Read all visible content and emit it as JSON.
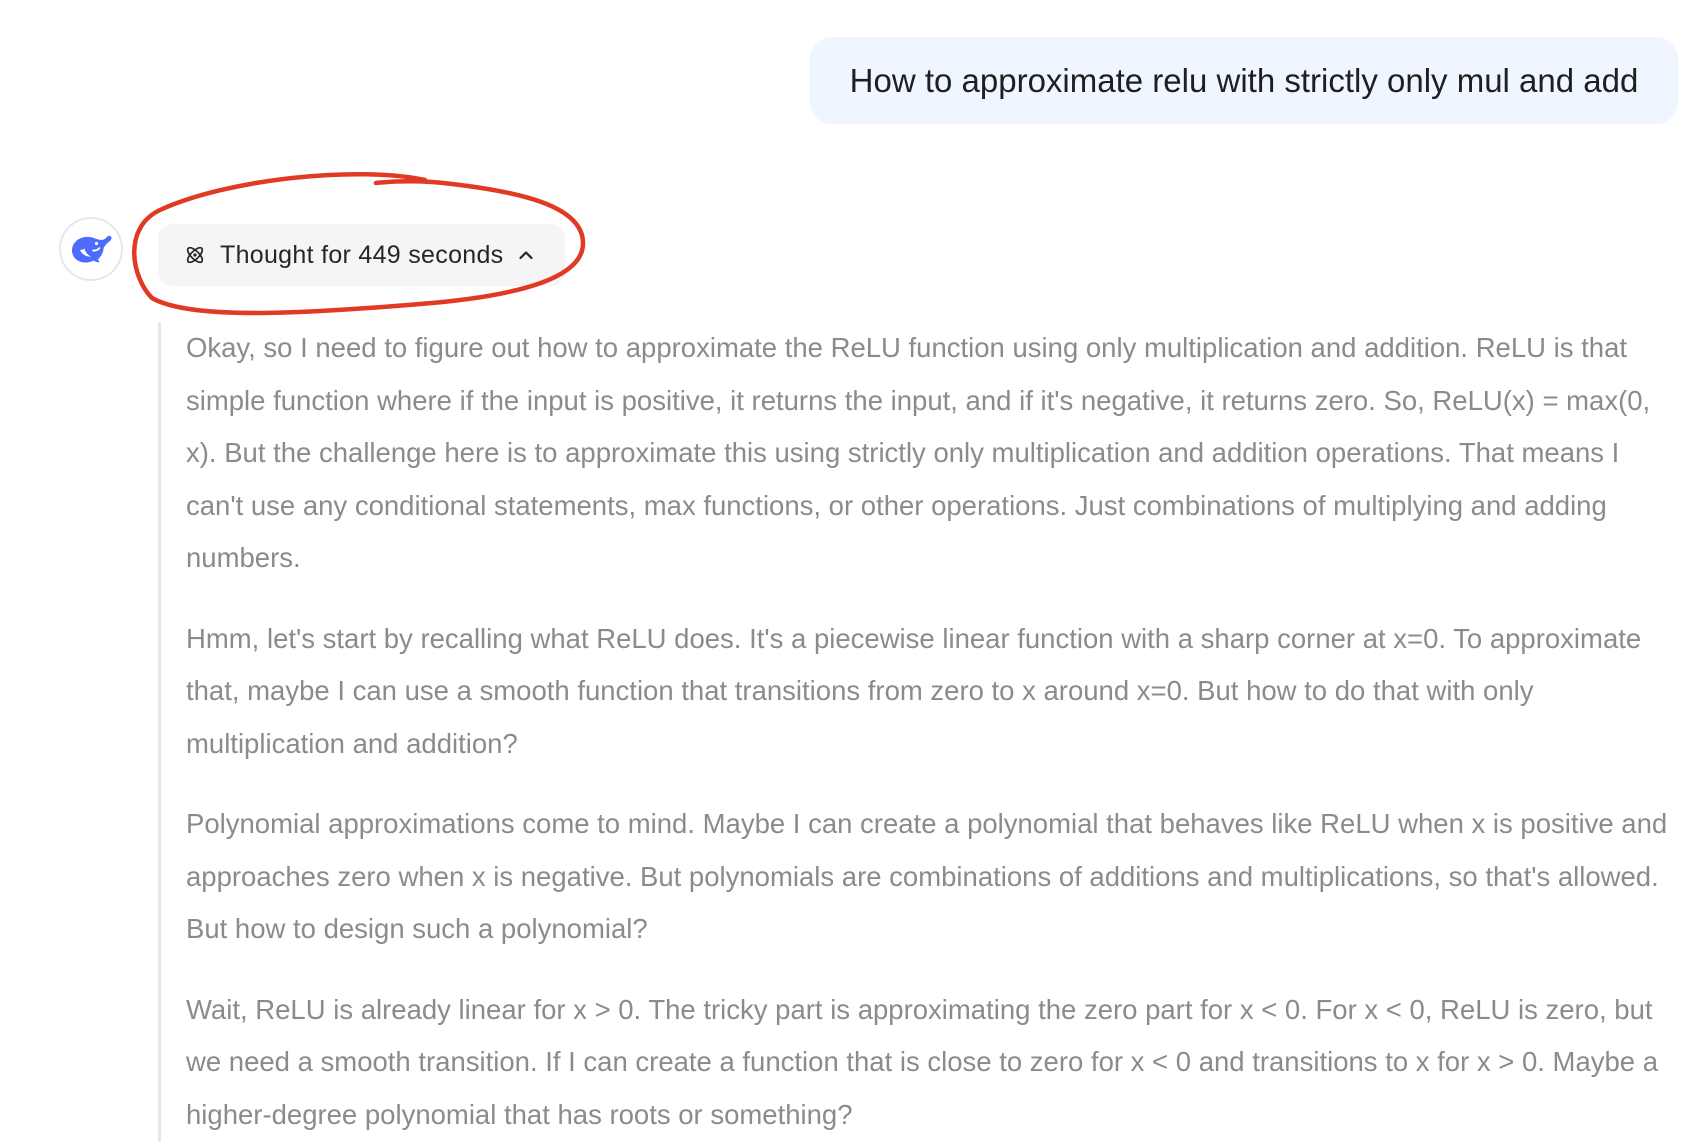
{
  "user_message": "How to approximate relu with strictly only mul and add",
  "assistant": {
    "avatar_icon": "deepseek-whale-icon",
    "brand_color": "#4d6bfe",
    "thought_toggle": {
      "label": "Thought for 449 seconds",
      "icon": "atom-icon",
      "chevron": "chevron-up-icon"
    },
    "thought_paragraphs": [
      "Okay, so I need to figure out how to approximate the ReLU function using only multiplication and addition. ReLU is that simple function where if the input is positive, it returns the input, and if it's negative, it returns zero. So, ReLU(x) = max(0, x). But the challenge here is to approximate this using strictly only multiplication and addition operations. That means I can't use any conditional statements, max functions, or other operations. Just combinations of multiplying and adding numbers.",
      "Hmm, let's start by recalling what ReLU does. It's a piecewise linear function with a sharp corner at x=0. To approximate that, maybe I can use a smooth function that transitions from zero to x around x=0. But how to do that with only multiplication and addition?",
      "Polynomial approximations come to mind. Maybe I can create a polynomial that behaves like ReLU when x is positive and approaches zero when x is negative. But polynomials are combinations of additions and multiplications, so that's allowed. But how to design such a polynomial?",
      "Wait, ReLU is already linear for x > 0. The tricky part is approximating the zero part for x < 0. For x < 0, ReLU is zero, but we need a smooth transition. If I can create a function that is close to zero for x < 0 and transitions to x for x > 0. Maybe a higher-degree polynomial that has roots or something?"
    ]
  },
  "annotation_color": "#e03a24"
}
